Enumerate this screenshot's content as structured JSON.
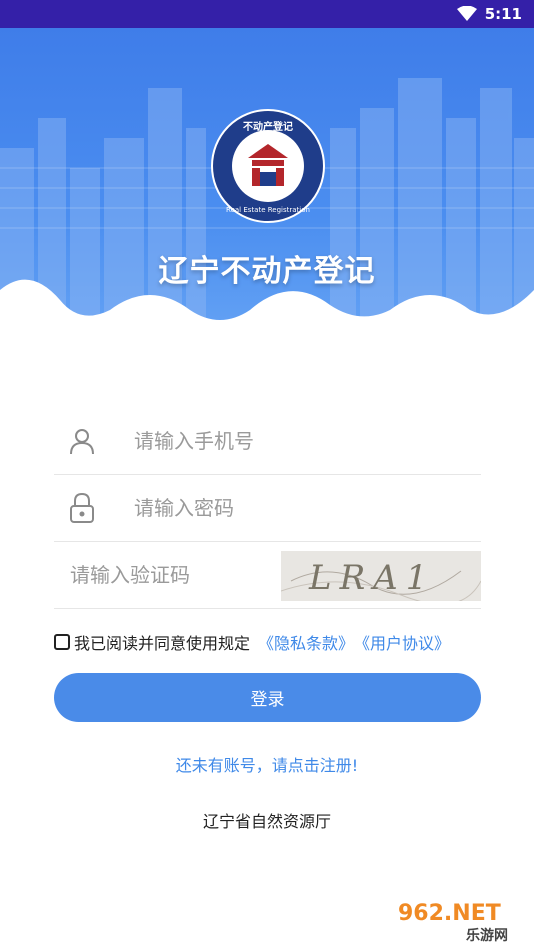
{
  "status_bar": {
    "time": "5:11"
  },
  "header": {
    "title": "辽宁不动产登记",
    "logo_top_text": "不动产登记",
    "logo_bottom_text": "Real Estate Registration"
  },
  "form": {
    "phone_placeholder": "请输入手机号",
    "password_placeholder": "请输入密码",
    "captcha_placeholder": "请输入验证码",
    "captcha_text": "LRA1"
  },
  "agreement": {
    "label": "我已阅读并同意使用规定",
    "privacy_link": "《隐私条款》",
    "user_link": "《用户协议》"
  },
  "login_label": "登录",
  "register_link": "还未有账号，请点击注册!",
  "footer_org": "辽宁省自然资源厅",
  "watermark": {
    "brand": "962.NET",
    "sub": "乐游网"
  },
  "colors": {
    "status_bar": "#3420a8",
    "primary": "#4a8be8",
    "link": "#3f89e8"
  }
}
